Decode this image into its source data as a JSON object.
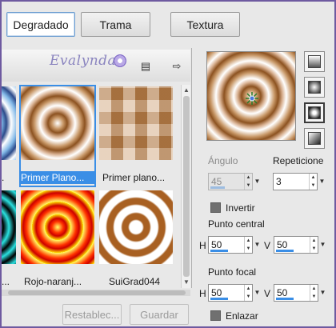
{
  "tabs": [
    {
      "label": "Degradado",
      "active": true
    },
    {
      "label": "Trama",
      "active": false
    },
    {
      "label": "Textura",
      "active": false
    }
  ],
  "strip": {
    "logo_text": "Evalynda",
    "presets": [
      {
        "label": "Primer Plano...",
        "selected": true
      },
      {
        "label": "Primer plano...",
        "selected": false
      },
      {
        "label": "Rojo-naranj...",
        "selected": false
      },
      {
        "label": "SuiGrad044",
        "selected": false
      }
    ]
  },
  "buttons": {
    "reset_label": "Restablec...",
    "save_label": "Guardar"
  },
  "controls": {
    "angle_label": "Ángulo",
    "angle_value": "45",
    "repeats_label": "Repeticione",
    "repeats_value": "3",
    "invert_label": "Invertir",
    "center_label": "Punto central",
    "center_h_label": "H",
    "center_h_value": "50",
    "center_v_label": "V",
    "center_v_value": "50",
    "focal_label": "Punto focal",
    "focal_h_label": "H",
    "focal_h_value": "50",
    "focal_v_label": "V",
    "focal_v_value": "50",
    "link_label": "Enlazar"
  },
  "colors": {
    "accent": "#3a8ee6",
    "brown": "#8c5220",
    "window_border": "#6e5aa0"
  }
}
